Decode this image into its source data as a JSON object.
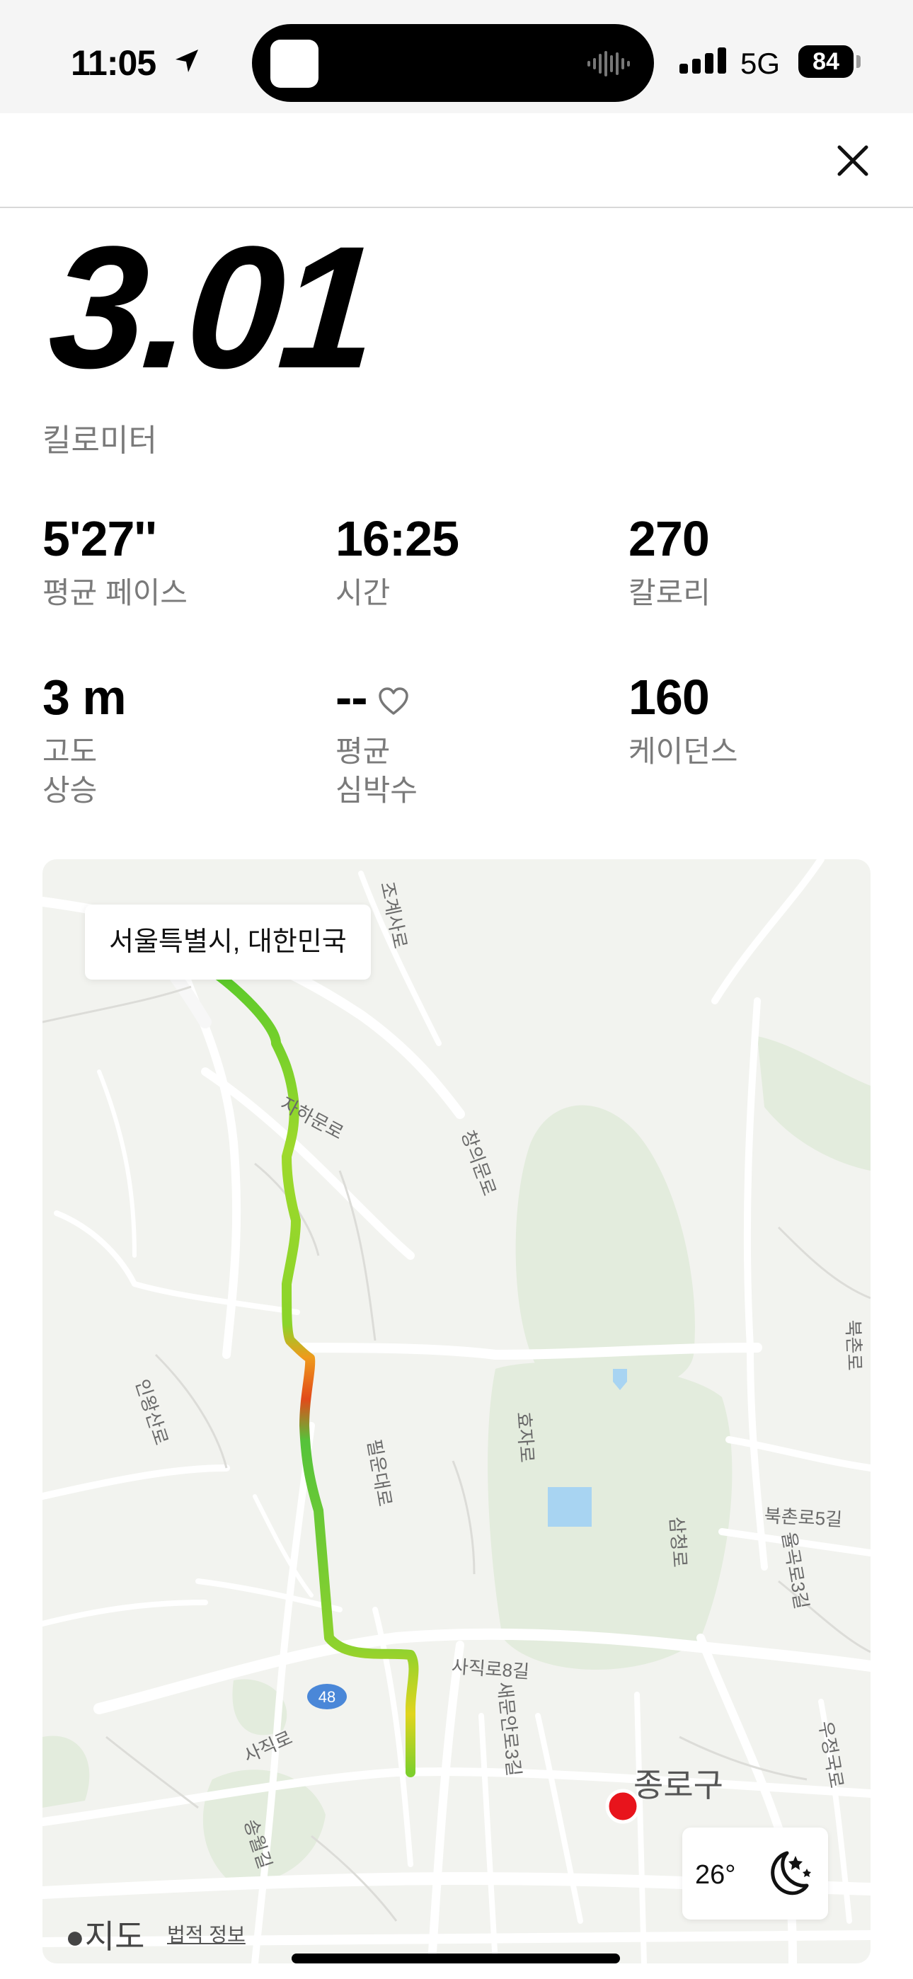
{
  "status_bar": {
    "time": "11:05",
    "network": "5G",
    "battery": "84"
  },
  "summary": {
    "distance": "3.01",
    "distance_unit": "킬로미터"
  },
  "stats": [
    {
      "value": "5'27''",
      "label": "평균 페이스"
    },
    {
      "value": "16:25",
      "label": "시간"
    },
    {
      "value": "270",
      "label": "칼로리"
    },
    {
      "value": "3 m",
      "label_line1": "고도",
      "label_line2": "상승"
    },
    {
      "value": "--",
      "label_line1": "평균",
      "label_line2": "심박수",
      "icon": "heart-icon"
    },
    {
      "value": "160",
      "label": "케이던스"
    }
  ],
  "map": {
    "callout": "서울특별시, 대한민국",
    "district": "종로구",
    "road_labels": [
      "조계사로",
      "창의문로",
      "자하문로",
      "인왕산로",
      "필운대로",
      "효자로",
      "삼청로",
      "북촌로5길",
      "율곡로3길",
      "사직로8길",
      "사직로",
      "새문안로3길",
      "우정국로",
      "북촌로",
      "송월길",
      "48"
    ],
    "weather_temp": "26°",
    "weather_icon": "moon-stars-icon",
    "brand": "지도",
    "legal": "법적 정보",
    "start_marker_color": "#4cc81e",
    "end_marker_color": "#e8141c"
  }
}
